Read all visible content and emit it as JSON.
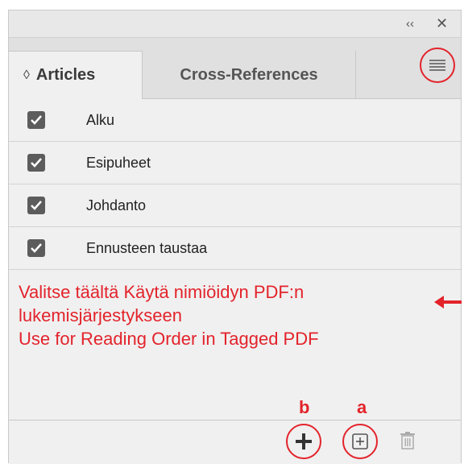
{
  "titlebar": {
    "collapse_icon": "double-chevron-left-icon",
    "close_icon": "close-icon"
  },
  "tabs": [
    {
      "label": "Articles",
      "active": true
    },
    {
      "label": "Cross-References",
      "active": false
    }
  ],
  "articles": [
    {
      "label": "Alku",
      "checked": true
    },
    {
      "label": "Esipuheet",
      "checked": true
    },
    {
      "label": "Johdanto",
      "checked": true
    },
    {
      "label": "Ennusteen taustaa",
      "checked": true
    }
  ],
  "annotation": {
    "line1": "Valitse täältä Käytä nimiöidyn PDF:n",
    "line2": "lukemisjärjestykseen",
    "line3": "Use for Reading Order in Tagged PDF"
  },
  "markers": {
    "b": "b",
    "a": "a"
  },
  "toolbar": {
    "add_icon": "plus-icon",
    "add_selected_icon": "plus-box-icon",
    "delete_icon": "trash-icon"
  },
  "colors": {
    "accent": "#e3232b",
    "panel_bg": "#f0f0f0",
    "checkbox": "#5c5c5c"
  }
}
